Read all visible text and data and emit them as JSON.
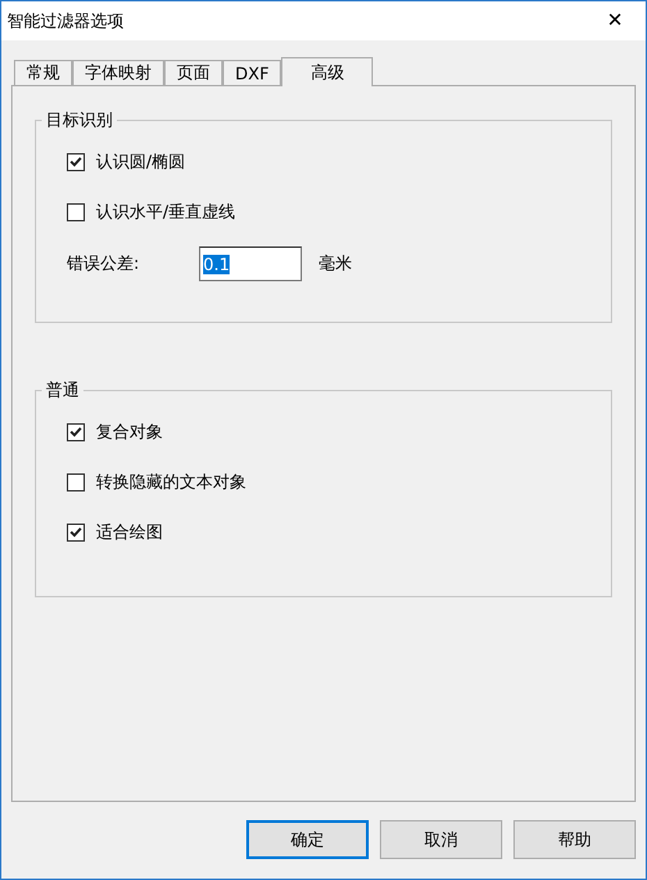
{
  "window": {
    "title": "智能过滤器选项",
    "close": "✕"
  },
  "tabs": [
    {
      "label": "常规",
      "selected": false
    },
    {
      "label": "字体映射",
      "selected": false
    },
    {
      "label": "页面",
      "selected": false
    },
    {
      "label": "DXF",
      "selected": false
    },
    {
      "label": "高级",
      "selected": true
    }
  ],
  "groups": [
    {
      "title": "目标识别",
      "items": [
        {
          "kind": "checkbox",
          "label": "认识圆/椭圆",
          "checked": true
        },
        {
          "kind": "checkbox",
          "label": "认识水平/垂直虚线",
          "checked": false
        },
        {
          "kind": "field",
          "label": "错误公差:",
          "value": "0.1",
          "unit": "毫米"
        }
      ]
    },
    {
      "title": "普通",
      "items": [
        {
          "kind": "checkbox",
          "label": "复合对象",
          "checked": true
        },
        {
          "kind": "checkbox",
          "label": "转换隐藏的文本对象",
          "checked": false
        },
        {
          "kind": "checkbox",
          "label": "适合绘图",
          "checked": true
        }
      ]
    }
  ],
  "buttons": [
    "确定",
    "取消",
    "帮助"
  ]
}
